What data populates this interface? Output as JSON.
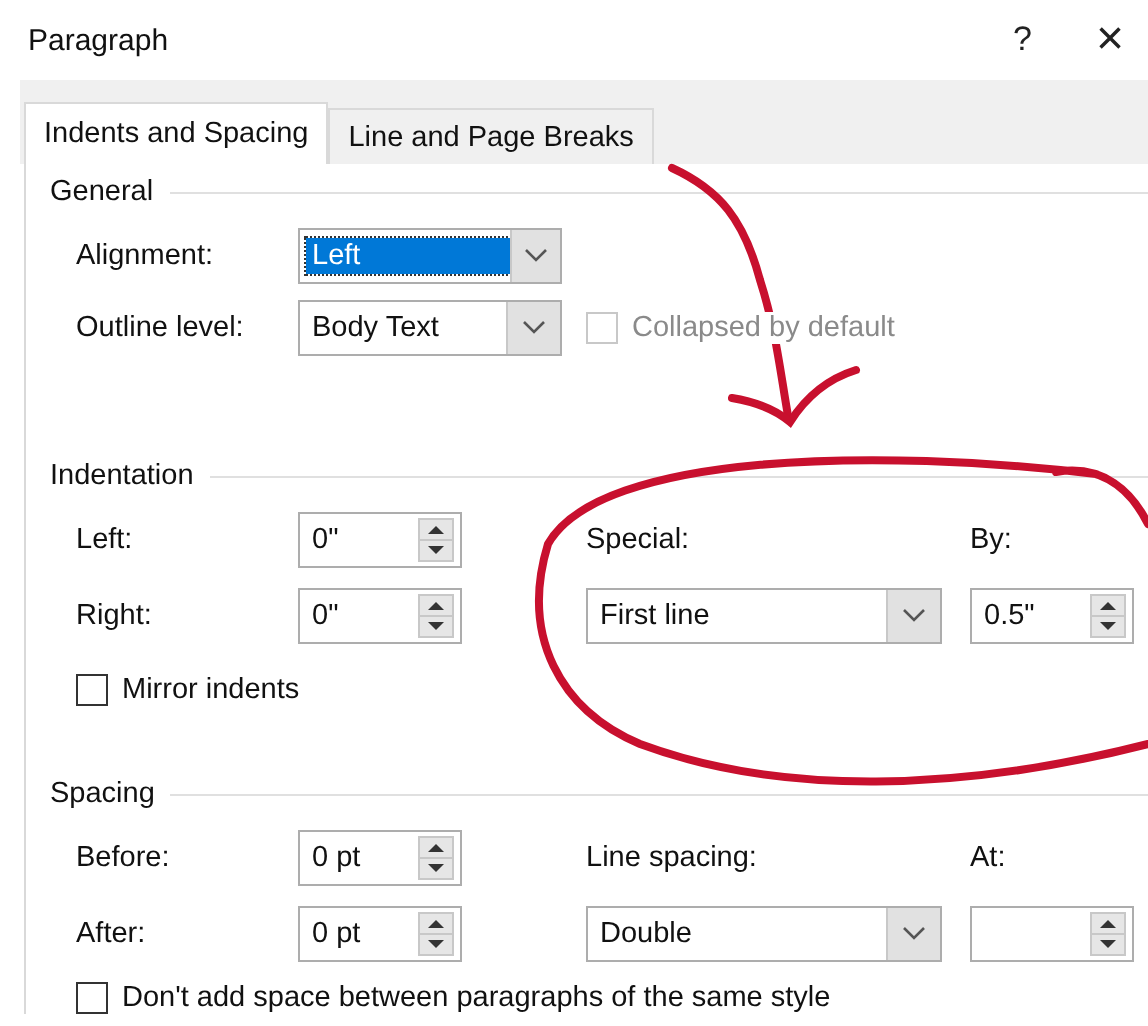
{
  "window": {
    "title": "Paragraph",
    "help_button": "?",
    "close_button": "×"
  },
  "tabs": [
    {
      "label": "Indents and Spacing",
      "selected": true
    },
    {
      "label": "Line and Page Breaks",
      "selected": false
    }
  ],
  "general": {
    "heading": "General",
    "alignment": {
      "label": "Alignment:",
      "value": "Left",
      "highlighted": true
    },
    "outline_level": {
      "label": "Outline level:",
      "value": "Body Text",
      "highlighted": false
    },
    "collapsed": {
      "label": "Collapsed by default",
      "checked": false,
      "disabled": true
    }
  },
  "indentation": {
    "heading": "Indentation",
    "left": {
      "label": "Left:",
      "value": "0\""
    },
    "right": {
      "label": "Right:",
      "value": "0\""
    },
    "special": {
      "label": "Special:",
      "value": "First line",
      "highlighted": false
    },
    "by": {
      "label": "By:",
      "value": "0.5\""
    },
    "mirror": {
      "label": "Mirror indents",
      "checked": false,
      "disabled": false
    }
  },
  "spacing": {
    "heading": "Spacing",
    "before": {
      "label": "Before:",
      "value": "0 pt"
    },
    "after": {
      "label": "After:",
      "value": "0 pt"
    },
    "line_spacing": {
      "label": "Line spacing:",
      "value": "Double",
      "highlighted": false
    },
    "at": {
      "label": "At:"
    },
    "dont_add": {
      "label": "Don't add space between paragraphs of the same style",
      "checked": false,
      "disabled": false
    }
  }
}
